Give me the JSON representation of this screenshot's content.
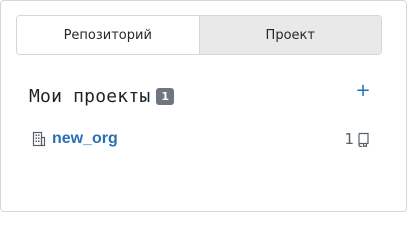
{
  "tabs": [
    {
      "label": "Репозиторий",
      "active": true
    },
    {
      "label": "Проект",
      "active": false
    }
  ],
  "section": {
    "title": "Мои проекты",
    "count": "1",
    "add_label": "+"
  },
  "orgs": [
    {
      "name": "new_org",
      "repo_count": "1",
      "icon": "organization-icon"
    }
  ],
  "colors": {
    "link": "#2c6fb3",
    "badge": "#6e7781",
    "inactive_tab": "#e9e9e9"
  }
}
